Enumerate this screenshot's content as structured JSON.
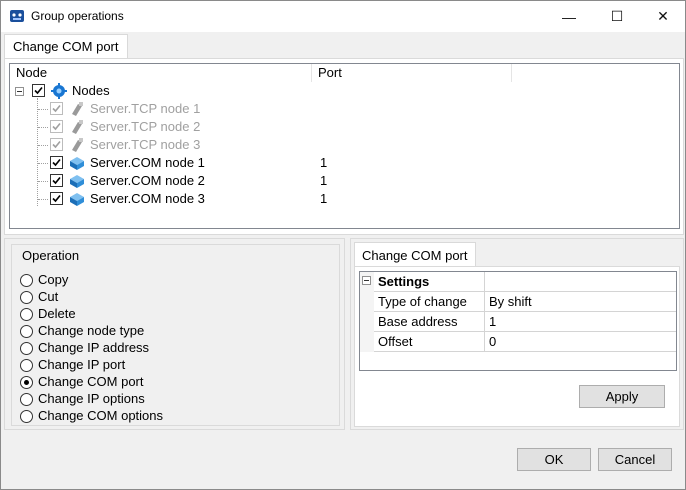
{
  "window": {
    "title": "Group operations",
    "minimize": "—",
    "maximize": "☐",
    "close": "✕"
  },
  "tabs": [
    "Change COM port"
  ],
  "tree": {
    "columns": [
      "Node",
      "Port"
    ],
    "root": {
      "label": "Nodes",
      "checked": true,
      "icon": "nodes-icon"
    },
    "nodes": [
      {
        "label": "Server.TCP node 1",
        "port": "",
        "checked": true,
        "disabled": true,
        "icon": "tcp-node-icon"
      },
      {
        "label": "Server.TCP node 2",
        "port": "",
        "checked": true,
        "disabled": true,
        "icon": "tcp-node-icon"
      },
      {
        "label": "Server.TCP node 3",
        "port": "",
        "checked": true,
        "disabled": true,
        "icon": "tcp-node-icon"
      },
      {
        "label": "Server.COM node 1",
        "port": "1",
        "checked": true,
        "disabled": false,
        "icon": "com-node-icon"
      },
      {
        "label": "Server.COM node 2",
        "port": "1",
        "checked": true,
        "disabled": false,
        "icon": "com-node-icon"
      },
      {
        "label": "Server.COM node 3",
        "port": "1",
        "checked": true,
        "disabled": false,
        "icon": "com-node-icon"
      }
    ]
  },
  "operation": {
    "title": "Operation",
    "options": [
      {
        "label": "Copy",
        "selected": false
      },
      {
        "label": "Cut",
        "selected": false
      },
      {
        "label": "Delete",
        "selected": false
      },
      {
        "label": "Change node type",
        "selected": false
      },
      {
        "label": "Change IP address",
        "selected": false
      },
      {
        "label": "Change IP port",
        "selected": false
      },
      {
        "label": "Change COM port",
        "selected": true
      },
      {
        "label": "Change IP options",
        "selected": false
      },
      {
        "label": "Change COM options",
        "selected": false
      }
    ]
  },
  "settings_panel": {
    "tab": "Change COM port",
    "group": "Settings",
    "rows": [
      {
        "name": "Type of change",
        "value": "By shift"
      },
      {
        "name": "Base address",
        "value": "1"
      },
      {
        "name": "Offset",
        "value": "0"
      }
    ],
    "apply": "Apply"
  },
  "footer": {
    "ok": "OK",
    "cancel": "Cancel"
  },
  "colors": {
    "accent": "#0078d7",
    "disabled_text": "#a0a0a0"
  }
}
